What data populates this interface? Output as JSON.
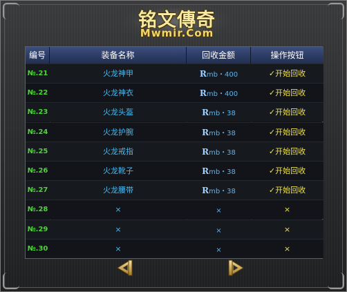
{
  "logo": {
    "title": "铭文傳奇",
    "subtitle": "Mwmir.Com"
  },
  "table": {
    "headers": [
      "编号",
      "装备名称",
      "回收金额",
      "操作按钮"
    ],
    "rows": [
      {
        "id": "№.21",
        "name": "火龙神甲",
        "price_prefix": "R",
        "price_rest": "mb・400",
        "action": "✓开始回收"
      },
      {
        "id": "№.22",
        "name": "火龙神衣",
        "price_prefix": "R",
        "price_rest": "mb・400",
        "action": "✓开始回收"
      },
      {
        "id": "№.23",
        "name": "火龙头盔",
        "price_prefix": "R",
        "price_rest": "mb・38",
        "action": "✓开始回收"
      },
      {
        "id": "№.24",
        "name": "火龙护腕",
        "price_prefix": "R",
        "price_rest": "mb・38",
        "action": "✓开始回收"
      },
      {
        "id": "№.25",
        "name": "火龙戒指",
        "price_prefix": "R",
        "price_rest": "mb・38",
        "action": "✓开始回收"
      },
      {
        "id": "№.26",
        "name": "火龙靴子",
        "price_prefix": "R",
        "price_rest": "mb・38",
        "action": "✓开始回收"
      },
      {
        "id": "№.27",
        "name": "火龙腰带",
        "price_prefix": "R",
        "price_rest": "mb・38",
        "action": "✓开始回收"
      },
      {
        "id": "№.28",
        "name": "×",
        "price_prefix": "",
        "price_rest": "×",
        "action": "×"
      },
      {
        "id": "№.29",
        "name": "×",
        "price_prefix": "",
        "price_rest": "×",
        "action": "×"
      },
      {
        "id": "№.30",
        "name": "×",
        "price_prefix": "",
        "price_rest": "×",
        "action": "×"
      }
    ]
  },
  "nav": {
    "prev_icon": "arrow-left-icon",
    "next_icon": "arrow-right-icon"
  },
  "colors": {
    "header_bg": "#2b3a62",
    "id_green": "#4fd23a",
    "name_blue": "#48b9f0",
    "action_yellow": "#f0e24a",
    "logo_gold": "#f3d66b"
  }
}
